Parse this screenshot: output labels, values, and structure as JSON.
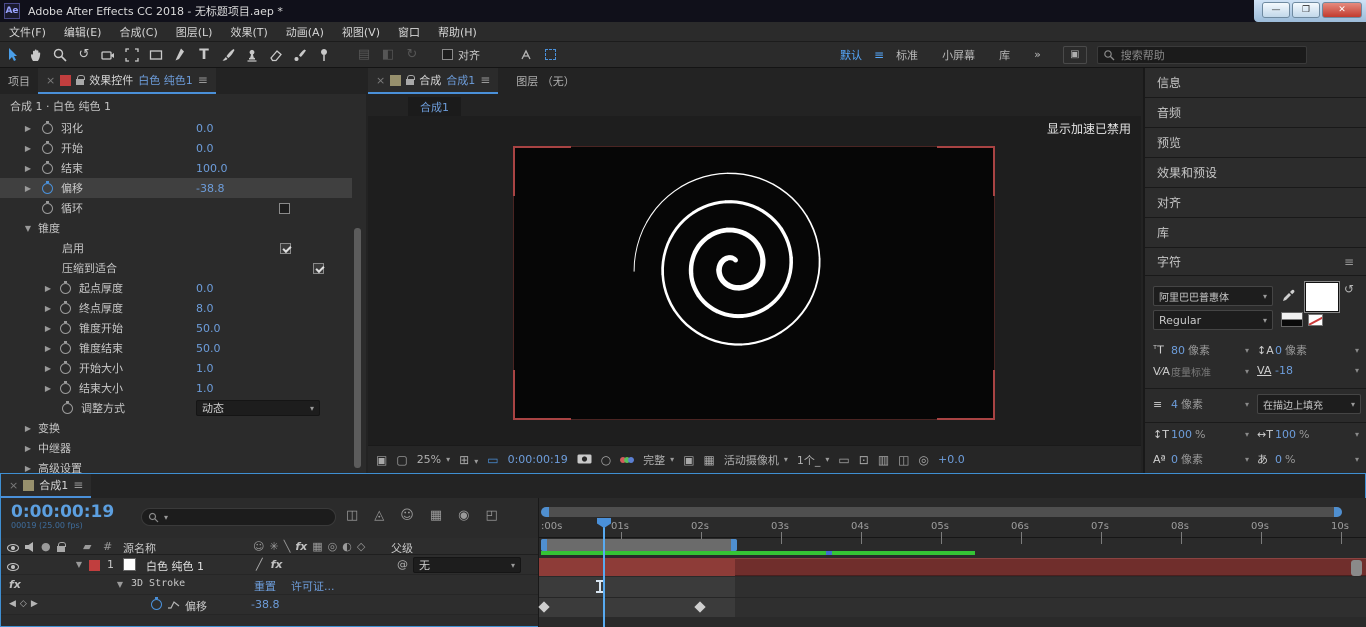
{
  "window": {
    "logo": "Ae",
    "title": "Adobe After Effects CC 2018 - 无标题项目.aep *"
  },
  "menu_bar": {
    "items": [
      "文件(F)",
      "编辑(E)",
      "合成(C)",
      "图层(L)",
      "效果(T)",
      "动画(A)",
      "视图(V)",
      "窗口",
      "帮助(H)"
    ]
  },
  "toolbar": {
    "tools": [
      "selection",
      "hand",
      "zoom",
      "rotation",
      "camera",
      "pan-behind",
      "rectangle",
      "pen",
      "text",
      "brush",
      "clone-stamp",
      "eraser",
      "roto-brush",
      "puppet-pin"
    ],
    "snap_label": "对齐",
    "workspace_tabs": [
      "默认",
      "标准",
      "小屏幕",
      "库"
    ],
    "workspace_overflow": "»",
    "search_placeholder": "搜索帮助"
  },
  "effect_controls": {
    "tab_project": "项目",
    "tab_title": "效果控件",
    "tab_target": "白色 纯色1",
    "breadcrumb": "合成 1 · 白色 纯色 1",
    "rows": [
      {
        "name": "羽化",
        "value": "0.0",
        "kind": "param"
      },
      {
        "name": "开始",
        "value": "0.0",
        "kind": "param"
      },
      {
        "name": "结束",
        "value": "100.0",
        "kind": "param"
      },
      {
        "name": "偏移",
        "value": "-38.8",
        "kind": "param",
        "highlight": true,
        "stopwatch_active": true
      },
      {
        "name": "循环",
        "kind": "checkbox",
        "checked": false
      },
      {
        "name": "锥度",
        "kind": "group",
        "expanded": true
      },
      {
        "name": "启用",
        "kind": "checkbox",
        "checked": true
      },
      {
        "name": "压缩到适合",
        "kind": "checkbox",
        "checked": true
      },
      {
        "name": "起点厚度",
        "value": "0.0",
        "kind": "param"
      },
      {
        "name": "终点厚度",
        "value": "8.0",
        "kind": "param"
      },
      {
        "name": "锥度开始",
        "value": "50.0",
        "kind": "param"
      },
      {
        "name": "锥度结束",
        "value": "50.0",
        "kind": "param"
      },
      {
        "name": "开始大小",
        "value": "1.0",
        "kind": "param"
      },
      {
        "name": "结束大小",
        "value": "1.0",
        "kind": "param"
      },
      {
        "name": "调整方式",
        "value": "动态",
        "kind": "dropdown"
      },
      {
        "name": "变换",
        "kind": "group",
        "expanded": false
      },
      {
        "name": "中继器",
        "kind": "group",
        "expanded": false
      },
      {
        "name": "高级设置",
        "kind": "group",
        "expanded": false
      }
    ]
  },
  "composition": {
    "tab_title": "合成",
    "tab_target": "合成1",
    "layer_tab": "图层 （无）",
    "sub_tab": "合成1",
    "overlay_message": "显示加速已禁用",
    "statusbar": {
      "zoom": "25%",
      "time": "0:00:00:19",
      "resolution": "完整",
      "camera": "活动摄像机",
      "views": "1个_",
      "exposure": "+0.0"
    }
  },
  "right_panels": {
    "collapsed": [
      "信息",
      "音频",
      "预览",
      "效果和预设",
      "对齐",
      "库"
    ],
    "character": {
      "title": "字符",
      "font_family": "阿里巴巴普惠体",
      "font_style": "Regular",
      "font_size": "80",
      "font_size_unit": "像素",
      "leading": "0",
      "leading_unit": "像素",
      "kerning": "度量标准",
      "tracking": "-18",
      "stroke_width": "4",
      "stroke_width_unit": "像素",
      "fill_mode": "在描边上填充",
      "v_scale": "100",
      "v_scale_unit": "%",
      "h_scale": "100",
      "h_scale_unit": "%",
      "baseline": "0",
      "baseline_unit": "像素",
      "tsume": "0",
      "tsume_unit": "%"
    }
  },
  "timeline": {
    "tab": "合成1",
    "timecode": "0:00:00:19",
    "frame_info": "00019 (25.00 fps)",
    "columns": {
      "source_name": "源名称",
      "parent": "父级"
    },
    "ruler": [
      ":00s",
      "01s",
      "02s",
      "03s",
      "04s",
      "05s",
      "06s",
      "07s",
      "08s",
      "09s",
      "10s"
    ],
    "layer": {
      "index": "1",
      "name": "白色 纯色 1",
      "parent": "无"
    },
    "effect": {
      "name": "3D Stroke",
      "link_reset": "重置",
      "link_license": "许可证..."
    },
    "property": {
      "name": "偏移",
      "value": "-38.8"
    }
  },
  "colors": {
    "accent_blue": "#4a90d9",
    "value_blue": "#6d9ddb",
    "render_green": "#3fbf3f",
    "layer_bar_red": "#8e3c38",
    "label_red": "#c13e3e"
  }
}
